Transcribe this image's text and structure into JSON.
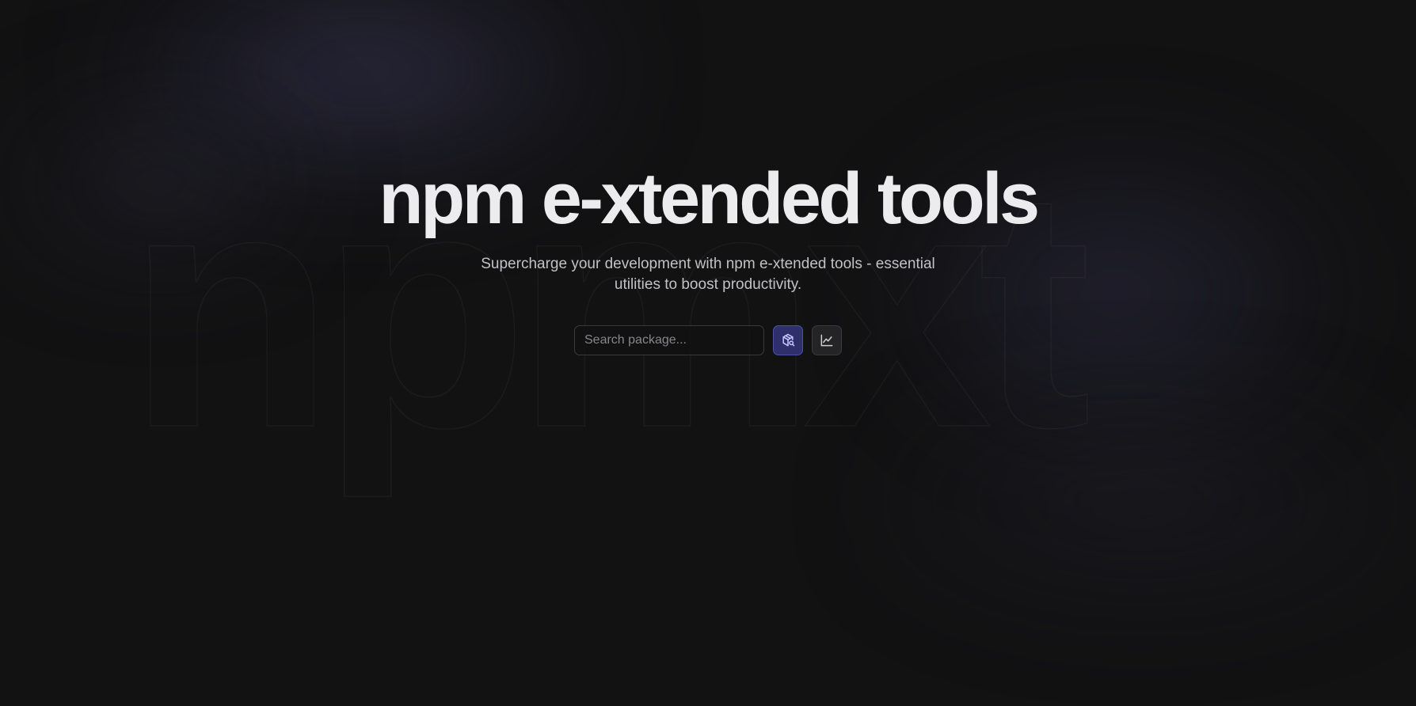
{
  "background_watermark": "npmxt",
  "hero": {
    "title": "npm e-xtended tools",
    "subtitle": "Supercharge your development with npm e-xtended tools - essential utilities to boost productivity."
  },
  "search": {
    "placeholder": "Search package...",
    "value": ""
  },
  "actions": {
    "search_button_icon": "package-search-icon",
    "chart_button_icon": "line-chart-icon"
  },
  "colors": {
    "background": "#121213",
    "accent": "#4f51a8",
    "title": "#ececee",
    "subtitle": "#c2c2c6"
  }
}
